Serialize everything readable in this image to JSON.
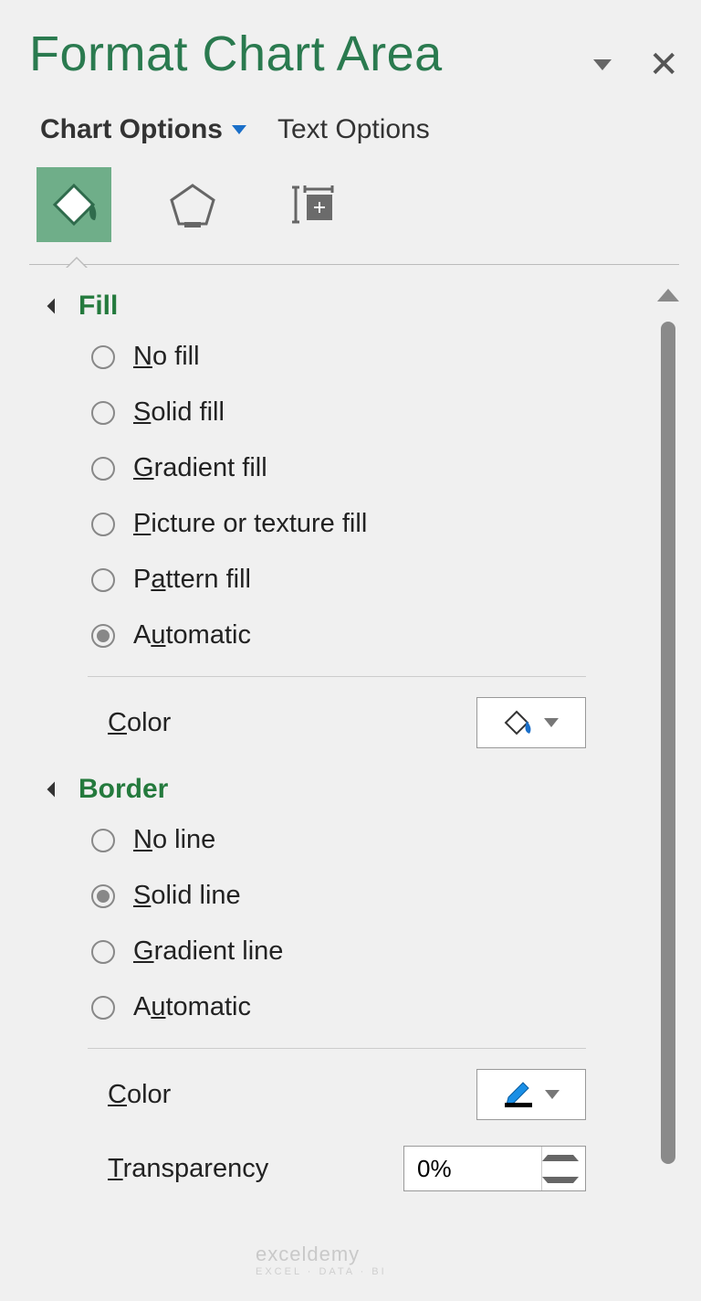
{
  "header": {
    "title": "Format Chart Area"
  },
  "tabs": {
    "chart_options": "Chart Options",
    "text_options": "Text Options",
    "active": "chart_options"
  },
  "icon_tabs": {
    "fill_line": "fill-line",
    "effects": "effects",
    "size": "size-properties"
  },
  "fill": {
    "title": "Fill",
    "options": {
      "no_fill": "No fill",
      "solid_fill": "Solid fill",
      "gradient_fill": "Gradient fill",
      "picture_fill": "Picture or texture fill",
      "pattern_fill": "Pattern fill",
      "automatic": "Automatic"
    },
    "selected": "automatic",
    "color_label": "Color"
  },
  "border": {
    "title": "Border",
    "options": {
      "no_line": "No line",
      "solid_line": "Solid line",
      "gradient_line": "Gradient line",
      "automatic": "Automatic"
    },
    "selected": "solid_line",
    "color_label": "Color",
    "transparency_label": "Transparency",
    "transparency_value": "0%"
  },
  "watermark": {
    "text": "exceldemy",
    "sub": "EXCEL · DATA · BI"
  }
}
